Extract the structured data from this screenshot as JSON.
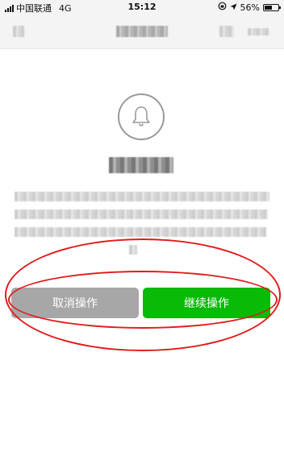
{
  "status_bar": {
    "carrier": "中国联通",
    "network": "4G",
    "time": "15:12",
    "battery": "56%",
    "battery_level": 0.56
  },
  "dialog": {
    "icon": "bell-icon",
    "cancel_label": "取消操作",
    "continue_label": "继续操作"
  },
  "colors": {
    "continue_button": "#09bb07",
    "cancel_button": "#a7a7a7",
    "annotation": "#e01b1b"
  }
}
